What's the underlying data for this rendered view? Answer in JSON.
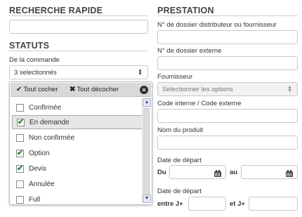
{
  "left": {
    "quick_search": {
      "title": "RECHERCHE RAPIDE",
      "value": ""
    },
    "statuts": {
      "title": "STATUTS",
      "order_label": "De la commande",
      "order_select_value": "3 selectionnés",
      "dropdown": {
        "check_all": "Tout cocher",
        "uncheck_all": "Tout décocher",
        "items": [
          {
            "label": "Confirmée",
            "checked": false,
            "selected": false
          },
          {
            "label": "En demande",
            "checked": true,
            "selected": true
          },
          {
            "label": "Non confirmée",
            "checked": false,
            "selected": false
          },
          {
            "label": "Option",
            "checked": true,
            "selected": false
          },
          {
            "label": "Devis",
            "checked": true,
            "selected": false
          },
          {
            "label": "Annulée",
            "checked": false,
            "selected": false
          },
          {
            "label": "Full",
            "checked": false,
            "selected": false
          }
        ]
      }
    }
  },
  "right": {
    "title": "PRESTATION",
    "dossier_label": "N° de dossier distributeur ou fournisseur",
    "dossier_value": "",
    "external_label": "N° de dossier externe",
    "external_value": "",
    "supplier_label": "Fournisseur",
    "supplier_placeholder": "Selectionner les options",
    "code_label": "Code interne / Code externe",
    "code_value": "",
    "product_label": "Nom du produit",
    "product_value": "",
    "departure_label_1": "Date de départ",
    "from_label": "Du",
    "to_label": "au",
    "from_value": "",
    "to_value": "",
    "departure_label_2": "Date de départ",
    "start_label": "entre J+",
    "end_label": "et J+",
    "start_value": "",
    "end_value": ""
  },
  "colors": {
    "check": "#2e7d32",
    "header_bg": "#d9d9d9",
    "rule": "#cfcfcf"
  }
}
